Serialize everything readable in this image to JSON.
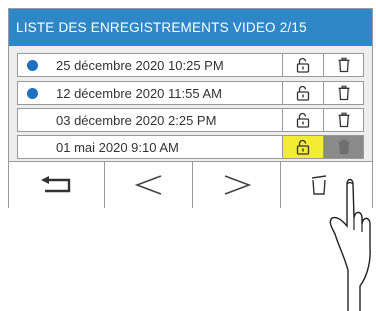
{
  "header": {
    "title": "LISTE DES ENREGISTREMENTS VIDEO 2/15"
  },
  "recordings": [
    {
      "label": "25 décembre 2020 10:25 PM",
      "new": true,
      "selected": false
    },
    {
      "label": "12 décembre 2020 11:55 AM",
      "new": true,
      "selected": false
    },
    {
      "label": "03 décembre 2020 2:25 PM",
      "new": false,
      "selected": false
    },
    {
      "label": "01 mai 2020 9:10 AM",
      "new": false,
      "selected": true
    }
  ],
  "icons": {
    "row_lock": "unlocked-padlock-icon",
    "row_delete": "trash-icon",
    "back": "back-arrow-icon",
    "prev": "chevron-left-icon",
    "next": "chevron-right-icon",
    "delete_all": "trash-icon"
  },
  "colors": {
    "header_bg": "#2f87c8",
    "new_dot": "#1f6fc0",
    "lock_selected_bg": "#f2ec34",
    "delete_selected_bg": "#8a8a8a"
  }
}
